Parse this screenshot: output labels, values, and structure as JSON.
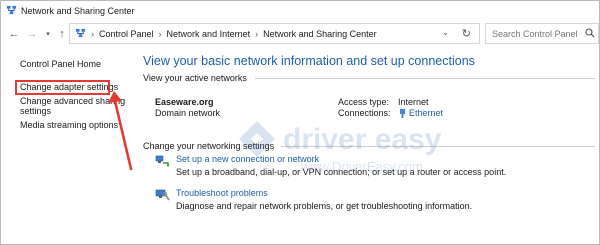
{
  "window": {
    "title": "Network and Sharing Center"
  },
  "address": {
    "crumbs": [
      "Control Panel",
      "Network and Internet",
      "Network and Sharing Center"
    ],
    "search_placeholder": "Search Control Panel"
  },
  "leftnav": {
    "home": "Control Panel Home",
    "adapter": "Change adapter settings",
    "sharing_line1": "Change advanced sharing",
    "sharing_line2": "settings",
    "media": "Media streaming options"
  },
  "main": {
    "title": "View your basic network information and set up connections",
    "active_head": "View your active networks",
    "network_name": "Easeware.org",
    "network_type": "Domain network",
    "access_label": "Access type:",
    "access_value": "Internet",
    "connections_label": "Connections:",
    "connections_value": "Ethernet",
    "settings_head": "Change your networking settings",
    "tasks": [
      {
        "link": "Set up a new connection or network",
        "desc": "Set up a broadband, dial-up, or VPN connection; or set up a router or access point."
      },
      {
        "link": "Troubleshoot problems",
        "desc": "Diagnose and repair network problems, or get troubleshooting information."
      }
    ]
  },
  "watermark": {
    "brand": "driver easy",
    "url": "www.DriverEasy.com"
  },
  "colors": {
    "link": "#1e5fa8",
    "highlight": "#e03c31"
  }
}
